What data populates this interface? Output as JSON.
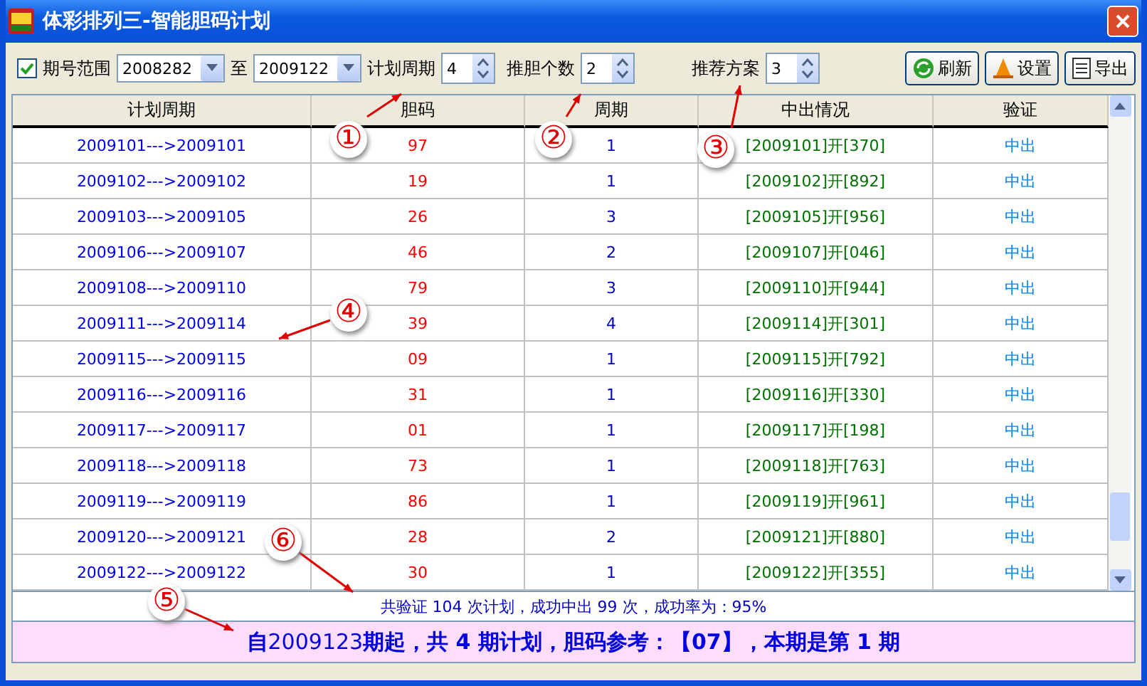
{
  "window": {
    "title": "体彩排列三-智能胆码计划"
  },
  "toolbar": {
    "range": {
      "label": "期号范围",
      "checked": true
    },
    "from": "2008282",
    "to_label": "至",
    "to": "2009122",
    "spinners": [
      {
        "label": "计划周期",
        "value": "4"
      },
      {
        "label": "推胆个数",
        "value": "2"
      },
      {
        "label": "推荐方案",
        "value": "3"
      }
    ],
    "buttons": [
      {
        "label": "刷新",
        "kind": "refresh"
      },
      {
        "label": "设置",
        "kind": "settings"
      },
      {
        "label": "导出",
        "kind": "export"
      }
    ]
  },
  "table": {
    "columns": [
      "计划周期",
      "胆码",
      "周期",
      "中出情况",
      "验证"
    ],
    "rows": [
      [
        "2009101--->2009101",
        "97",
        "1",
        "[2009101]开[370]",
        "中出"
      ],
      [
        "2009102--->2009102",
        "19",
        "1",
        "[2009102]开[892]",
        "中出"
      ],
      [
        "2009103--->2009105",
        "26",
        "3",
        "[2009105]开[956]",
        "中出"
      ],
      [
        "2009106--->2009107",
        "46",
        "2",
        "[2009107]开[046]",
        "中出"
      ],
      [
        "2009108--->2009110",
        "79",
        "3",
        "[2009110]开[944]",
        "中出"
      ],
      [
        "2009111--->2009114",
        "39",
        "4",
        "[2009114]开[301]",
        "中出"
      ],
      [
        "2009115--->2009115",
        "09",
        "1",
        "[2009115]开[792]",
        "中出"
      ],
      [
        "2009116--->2009116",
        "31",
        "1",
        "[2009116]开[330]",
        "中出"
      ],
      [
        "2009117--->2009117",
        "01",
        "1",
        "[2009117]开[198]",
        "中出"
      ],
      [
        "2009118--->2009118",
        "73",
        "1",
        "[2009118]开[763]",
        "中出"
      ],
      [
        "2009119--->2009119",
        "86",
        "1",
        "[2009119]开[961]",
        "中出"
      ],
      [
        "2009120--->2009121",
        "28",
        "2",
        "[2009121]开[880]",
        "中出"
      ],
      [
        "2009122--->2009122",
        "30",
        "1",
        "[2009122]开[355]",
        "中出"
      ]
    ]
  },
  "summary": "共验证 104 次计划，成功中出 99 次，成功率为：95%",
  "plan": "**自**2009123**期起，共 4 期计划，胆码参考：【07】，本期是第 1 期**",
  "annotations": [
    "①",
    "②",
    "③",
    "④",
    "⑤",
    "⑥"
  ]
}
